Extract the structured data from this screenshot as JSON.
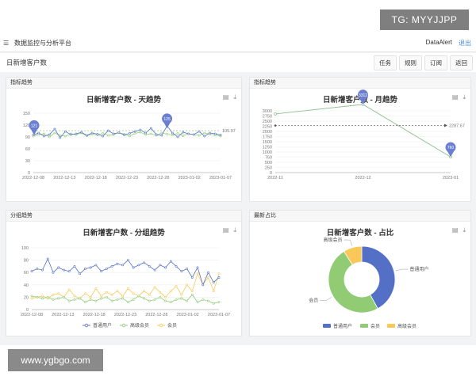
{
  "watermark_top": "TG: MYYJJPP",
  "watermark_bottom": "www.ygbgo.com",
  "topbar": {
    "title": "数据监控与分析平台",
    "app_name": "DataAlert",
    "logout": "退出"
  },
  "subbar": {
    "page_title": "日新增客户数",
    "tabs": [
      "任务",
      "规则",
      "订阅",
      "返回"
    ]
  },
  "panels": {
    "daily": {
      "header": "指标趋势",
      "title": "日新增客户数 - 天趋势"
    },
    "monthly": {
      "header": "指标趋势",
      "title": "日新增客户数 - 月趋势"
    },
    "group": {
      "header": "分组趋势",
      "title": "日新增客户数 - 分组趋势"
    },
    "share": {
      "header": "最新占比",
      "title": "日新增客户数 - 占比"
    }
  },
  "colors": {
    "blue": "#5470c6",
    "green": "#91cc75",
    "yellow": "#fac858",
    "pin": "#6b7fd0"
  },
  "chart_data": [
    {
      "type": "line",
      "title": "日新增客户数 - 天趋势",
      "x_ticks": [
        "2022-12-08",
        "2022-12-13",
        "2022-12-18",
        "2022-12-23",
        "2022-12-28",
        "2023-01-02",
        "2023-01-07"
      ],
      "y_ticks": [
        0,
        30,
        60,
        90,
        120,
        150
      ],
      "ylim": [
        0,
        150
      ],
      "series": [
        {
          "values": [
            95,
            100,
            92,
            96,
            110,
            88,
            104,
            96,
            98,
            102,
            94,
            100,
            97,
            92,
            106,
            98,
            101,
            95,
            99,
            104,
            108,
            100,
            112,
            96,
            94,
            118,
            100,
            90,
            102,
            98,
            96,
            104,
            92,
            100,
            98,
            95
          ]
        },
        {
          "values": [
            92,
            96,
            98,
            90,
            100,
            94,
            92,
            98,
            96,
            100,
            93,
            97,
            95,
            99,
            94,
            96,
            101,
            97,
            92,
            99,
            102,
            96,
            98,
            94,
            100,
            97,
            95,
            99,
            93,
            98,
            96,
            94,
            100,
            97,
            95,
            92
          ]
        }
      ],
      "mark_points": [
        {
          "label": "121"
        },
        {
          "label": "125"
        }
      ],
      "mark_line": {
        "value": 105.97,
        "label": "105.97"
      }
    },
    {
      "type": "line",
      "title": "日新增客户数 - 月趋势",
      "categories": [
        "2022-11",
        "2022-12",
        "2023-01"
      ],
      "y_ticks": [
        0,
        250,
        500,
        750,
        1000,
        1250,
        1500,
        1750,
        2000,
        2250,
        2500,
        2750,
        3000
      ],
      "ylim": [
        0,
        3000
      ],
      "values": [
        2850,
        3312,
        760
      ],
      "mark_points": [
        {
          "label": "3312"
        },
        {
          "label": "760"
        }
      ],
      "mark_line": {
        "value": 2287.67,
        "label": "2287.67"
      }
    },
    {
      "type": "line",
      "title": "日新增客户数 - 分组趋势",
      "x_ticks": [
        "2022-12-08",
        "2022-12-13",
        "2022-12-18",
        "2022-12-23",
        "2022-12-28",
        "2023-01-02",
        "2023-01-07"
      ],
      "y_ticks": [
        0,
        20,
        40,
        60,
        80,
        100
      ],
      "ylim": [
        0,
        100
      ],
      "series": [
        {
          "name": "普通用户",
          "values": [
            62,
            66,
            64,
            82,
            60,
            68,
            64,
            62,
            70,
            58,
            66,
            68,
            72,
            62,
            66,
            70,
            74,
            72,
            80,
            68,
            72,
            76,
            70,
            64,
            72,
            68,
            78,
            70,
            62,
            66,
            52,
            68,
            40,
            60,
            44,
            52
          ]
        },
        {
          "name": "高级会员",
          "values": [
            22,
            20,
            18,
            20,
            16,
            18,
            20,
            14,
            16,
            18,
            12,
            16,
            14,
            18,
            20,
            14,
            16,
            18,
            12,
            16,
            22,
            18,
            14,
            16,
            20,
            14,
            12,
            16,
            18,
            14,
            24,
            12,
            16,
            14,
            10,
            12
          ]
        },
        {
          "name": "会员",
          "values": [
            18,
            20,
            22,
            18,
            24,
            26,
            20,
            32,
            22,
            18,
            26,
            20,
            34,
            22,
            28,
            24,
            30,
            22,
            34,
            26,
            22,
            30,
            24,
            36,
            28,
            20,
            30,
            38,
            24,
            40,
            30,
            58,
            40,
            52,
            30,
            58
          ]
        }
      ]
    },
    {
      "type": "pie",
      "title": "日新增客户数 - 占比",
      "series": [
        {
          "name": "普通用户",
          "value": 42
        },
        {
          "name": "会员",
          "value": 49
        },
        {
          "name": "高级会员",
          "value": 9
        }
      ]
    }
  ]
}
